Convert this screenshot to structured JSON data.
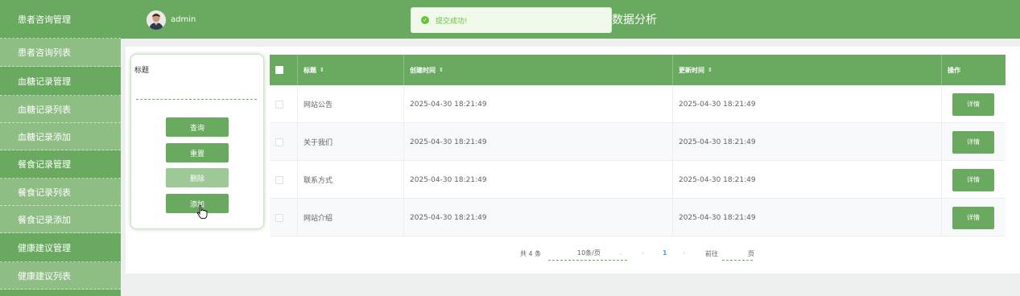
{
  "sidebar": {
    "items": [
      {
        "label": "患者咨询管理",
        "type": "group"
      },
      {
        "label": "患者咨询列表",
        "type": "child"
      },
      {
        "label": "血糖记录管理",
        "type": "group"
      },
      {
        "label": "血糖记录列表",
        "type": "child"
      },
      {
        "label": "血糖记录添加",
        "type": "child"
      },
      {
        "label": "餐食记录管理",
        "type": "group"
      },
      {
        "label": "餐食记录列表",
        "type": "child"
      },
      {
        "label": "餐食记录添加",
        "type": "child"
      },
      {
        "label": "健康建议管理",
        "type": "group"
      },
      {
        "label": "健康建议列表",
        "type": "child"
      }
    ]
  },
  "header": {
    "user": "admin",
    "title": "数据分析",
    "toast": "提交成功!"
  },
  "search": {
    "label": "标题",
    "value": "",
    "query_label": "查询",
    "reset_label": "重置",
    "delete_label": "删除",
    "add_label": "添加"
  },
  "table": {
    "columns": [
      "标题",
      "创建时间",
      "更新时间",
      "操作"
    ],
    "sort_icon": "⇕",
    "rows": [
      {
        "title": "网站公告",
        "created": "2025-04-30 18:21:49",
        "updated": "2025-04-30 18:21:49",
        "action": "详情"
      },
      {
        "title": "关于我们",
        "created": "2025-04-30 18:21:49",
        "updated": "2025-04-30 18:21:49",
        "action": "详情"
      },
      {
        "title": "联系方式",
        "created": "2025-04-30 18:21:49",
        "updated": "2025-04-30 18:21:49",
        "action": "详情"
      },
      {
        "title": "网站介绍",
        "created": "2025-04-30 18:21:49",
        "updated": "2025-04-30 18:21:49",
        "action": "详情"
      }
    ]
  },
  "pagination": {
    "total": "共 4 条",
    "page_size": "10条/页",
    "current": "1",
    "goto_prefix": "前往",
    "goto_suffix": "页"
  },
  "colors": {
    "primary": "#6aaa60",
    "primary_light": "#8fbe85",
    "toast_bg": "#f0f9eb",
    "toast_text": "#67c23a"
  }
}
